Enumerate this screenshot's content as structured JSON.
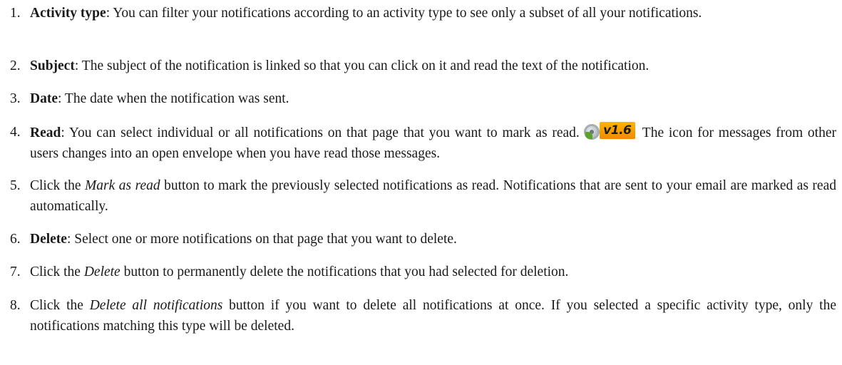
{
  "items": [
    {
      "number": "1.",
      "term": "Activity type",
      "text": ": You can filter your notifications according to an activity type to see only a subset of all your notifications."
    },
    {
      "number": "2.",
      "term": "Subject",
      "text": ": The subject of the notification is linked so that you can click on it and read the text of the notification."
    },
    {
      "number": "3.",
      "term": "Date",
      "text": ": The date when the notification was sent."
    },
    {
      "number": "4.",
      "term": "Read",
      "text": ": You can select individual or all notifications on that page that you want to mark as read.",
      "badge": {
        "label": "v1.6",
        "icon": "version-badge-icon"
      },
      "text_after": "The icon for messages from other users changes into an open envelope when you have read those messages."
    },
    {
      "number": "5.",
      "prefix": "Click the ",
      "emph": "Mark as read",
      "suffix": " button to mark the previously selected notifications as read. Notifications that are sent to your email are marked as read automatically."
    },
    {
      "number": "6.",
      "term": "Delete",
      "text": ": Select one or more notifications on that page that you want to delete."
    },
    {
      "number": "7.",
      "prefix": "Click the ",
      "emph": "Delete",
      "suffix": " button to permanently delete the notifications that you had selected for deletion."
    },
    {
      "number": "8.",
      "prefix": "Click the ",
      "emph": "Delete all notifications",
      "suffix": " button if you want to delete all notifications at once. If you selected a specific activity type, only the notifications matching this type will be deleted."
    }
  ]
}
